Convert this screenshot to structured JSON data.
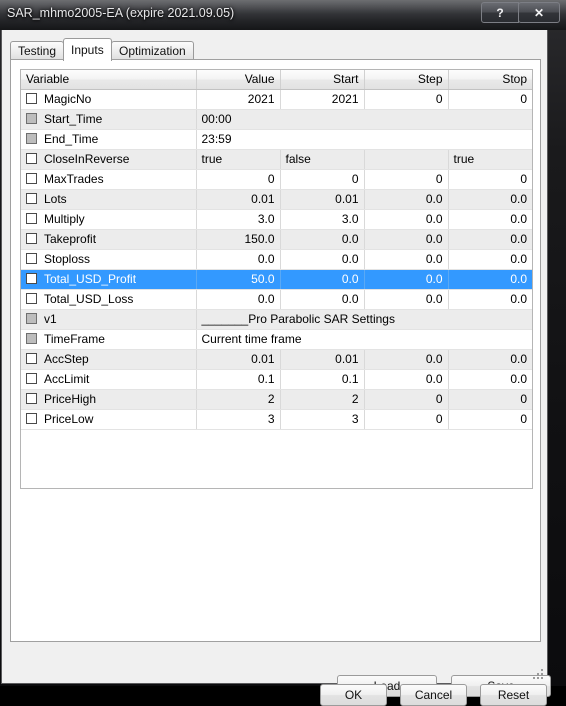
{
  "window": {
    "title": "SAR_mhmo2005-EA (expire 2021.09.05)",
    "help_label": "?",
    "close_label": "✕"
  },
  "tabs": [
    {
      "label": "Testing",
      "active": false
    },
    {
      "label": "Inputs",
      "active": true
    },
    {
      "label": "Optimization",
      "active": false
    }
  ],
  "table": {
    "columns": [
      "Variable",
      "Value",
      "Start",
      "Step",
      "Stop"
    ],
    "rows": [
      {
        "variable": "MagicNo",
        "checkbox": "unchecked",
        "mode": "numeric",
        "value": "2021",
        "start": "2021",
        "step": "0",
        "stop": "0",
        "selected": false
      },
      {
        "variable": "Start_Time",
        "checkbox": "disabled",
        "mode": "span",
        "value": "00:00",
        "start": "",
        "step": "",
        "stop": "",
        "selected": false
      },
      {
        "variable": "End_Time",
        "checkbox": "disabled",
        "mode": "span",
        "value": "23:59",
        "start": "",
        "step": "",
        "stop": "",
        "selected": false
      },
      {
        "variable": "CloseInReverse",
        "checkbox": "unchecked",
        "mode": "text",
        "value": "true",
        "start": "false",
        "step": "",
        "stop": "true",
        "selected": false
      },
      {
        "variable": "MaxTrades",
        "checkbox": "unchecked",
        "mode": "numeric",
        "value": "0",
        "start": "0",
        "step": "0",
        "stop": "0",
        "selected": false
      },
      {
        "variable": "Lots",
        "checkbox": "unchecked",
        "mode": "numeric",
        "value": "0.01",
        "start": "0.01",
        "step": "0.0",
        "stop": "0.0",
        "selected": false
      },
      {
        "variable": "Multiply",
        "checkbox": "unchecked",
        "mode": "numeric",
        "value": "3.0",
        "start": "3.0",
        "step": "0.0",
        "stop": "0.0",
        "selected": false
      },
      {
        "variable": "Takeprofit",
        "checkbox": "unchecked",
        "mode": "numeric",
        "value": "150.0",
        "start": "0.0",
        "step": "0.0",
        "stop": "0.0",
        "selected": false
      },
      {
        "variable": "Stoploss",
        "checkbox": "unchecked",
        "mode": "numeric",
        "value": "0.0",
        "start": "0.0",
        "step": "0.0",
        "stop": "0.0",
        "selected": false
      },
      {
        "variable": "Total_USD_Profit",
        "checkbox": "unchecked",
        "mode": "numeric",
        "value": "50.0",
        "start": "0.0",
        "step": "0.0",
        "stop": "0.0",
        "selected": true
      },
      {
        "variable": "Total_USD_Loss",
        "checkbox": "unchecked",
        "mode": "numeric",
        "value": "0.0",
        "start": "0.0",
        "step": "0.0",
        "stop": "0.0",
        "selected": false
      },
      {
        "variable": "v1",
        "checkbox": "disabled",
        "mode": "span",
        "value": "_______Pro Parabolic SAR Settings",
        "start": "",
        "step": "",
        "stop": "",
        "selected": false
      },
      {
        "variable": "TimeFrame",
        "checkbox": "disabled",
        "mode": "span",
        "value": "Current time frame",
        "start": "",
        "step": "",
        "stop": "",
        "selected": false
      },
      {
        "variable": "AccStep",
        "checkbox": "unchecked",
        "mode": "numeric",
        "value": "0.01",
        "start": "0.01",
        "step": "0.0",
        "stop": "0.0",
        "selected": false
      },
      {
        "variable": "AccLimit",
        "checkbox": "unchecked",
        "mode": "numeric",
        "value": "0.1",
        "start": "0.1",
        "step": "0.0",
        "stop": "0.0",
        "selected": false
      },
      {
        "variable": "PriceHigh",
        "checkbox": "unchecked",
        "mode": "numeric",
        "value": "2",
        "start": "2",
        "step": "0",
        "stop": "0",
        "selected": false
      },
      {
        "variable": "PriceLow",
        "checkbox": "unchecked",
        "mode": "numeric",
        "value": "3",
        "start": "3",
        "step": "0",
        "stop": "0",
        "selected": false
      }
    ]
  },
  "buttons": {
    "load": "Load",
    "save": "Save",
    "ok": "OK",
    "cancel": "Cancel",
    "reset": "Reset"
  },
  "colors": {
    "selection": "#3399ff",
    "row_alt": "#ececec",
    "titlebar": "#2b2b2e"
  }
}
